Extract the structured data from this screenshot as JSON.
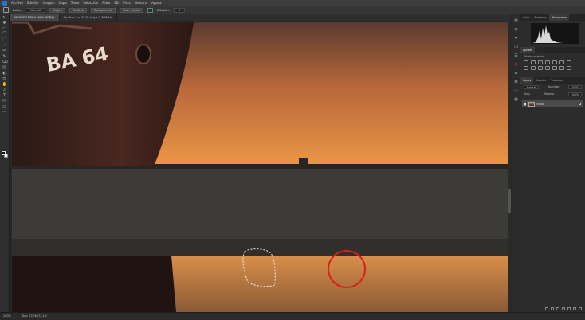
{
  "menu": [
    "Archivo",
    "Edición",
    "Imagen",
    "Capa",
    "Texto",
    "Selección",
    "Filtro",
    "3D",
    "Vista",
    "Ventana",
    "Ayuda"
  ],
  "options": {
    "style_label": "Estilo:",
    "style_value": "Normal",
    "btn_origin": "Origen",
    "btn_dest": "Destino",
    "btn_transparent": "Transparente",
    "btn_pattern": "Usar motivo",
    "spread_label": "Difusión:",
    "spread_value": "5"
  },
  "tabs": [
    "DSC04024.NEF al 100% (RGB/8)",
    "Sin título-1 al 33,3% (Capa 1, RGB/8#)"
  ],
  "status": {
    "zoom": "100%",
    "doc": "Doc: 72,1M/72,1M"
  },
  "tools": [
    "↖",
    "✥",
    "▭",
    "⌒",
    "⬚",
    "⌖",
    "✂",
    "✎",
    "⌫",
    "▤",
    "◐",
    "⬭",
    "✋",
    "⌕",
    "T",
    "⇱",
    "◻",
    "⋯"
  ],
  "right_strip": [
    "▦",
    "◔",
    "✱",
    "❒",
    "☰",
    "◉",
    "⬙",
    "⌘",
    "◌",
    "▣"
  ],
  "panels": {
    "top_tabs": [
      "Color",
      "Muestras",
      "Histograma"
    ],
    "props_tabs": [
      "Ajustes"
    ],
    "adj_label": "Añadir un ajuste",
    "layers_tabs": [
      "Capas",
      "Canales",
      "Trazados"
    ],
    "mode_label": "Normal",
    "opacity_label": "Opacidad:",
    "opacity_value": "100%",
    "lock_label": "Bloq.:",
    "fill_label": "Relleno:",
    "fill_value": "100%",
    "layer_name": "Fondo"
  },
  "colors": {
    "sky_top": "#6e4a36",
    "sky_bottom": "#e69043",
    "water": "#c07838",
    "highlight_circle": "#d8201c"
  }
}
